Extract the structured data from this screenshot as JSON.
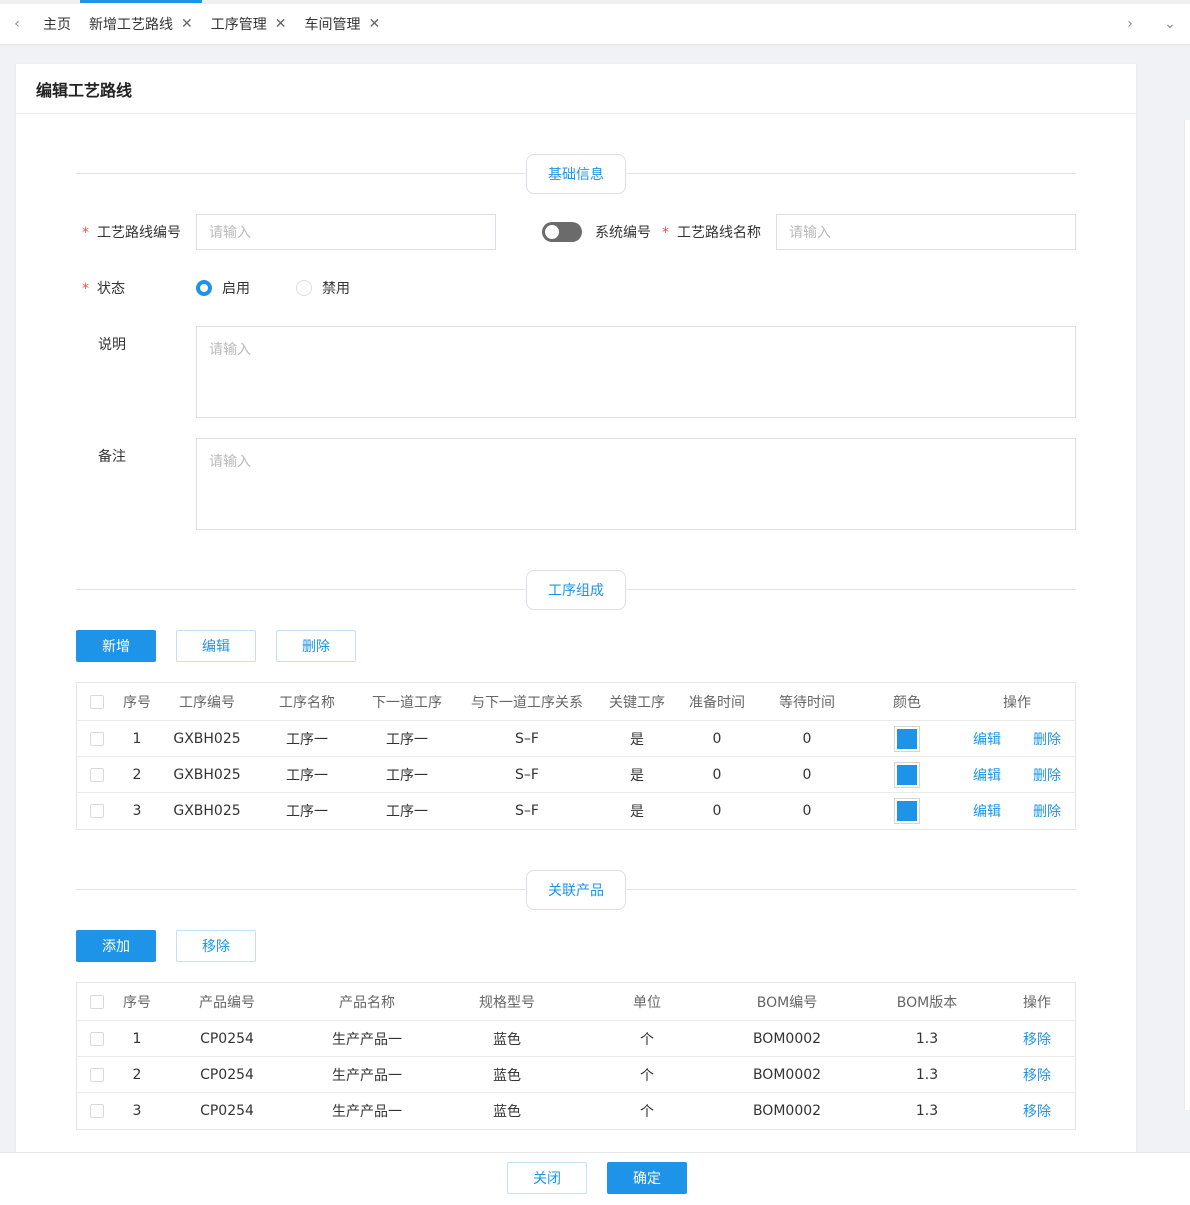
{
  "tabs": [
    {
      "label": "主页",
      "closable": false,
      "active": false
    },
    {
      "label": "新增工艺路线",
      "closable": true,
      "active": true
    },
    {
      "label": "工序管理",
      "closable": true,
      "active": false
    },
    {
      "label": "车间管理",
      "closable": true,
      "active": false
    }
  ],
  "icons": {
    "prev": "‹",
    "next": "›",
    "more": "⌄",
    "close": "✕"
  },
  "panel": {
    "title": "编辑工艺路线"
  },
  "sections": {
    "basic": "基础信息",
    "process": "工序组成",
    "product": "关联产品"
  },
  "form": {
    "route_code_label": "工艺路线编号",
    "route_code_placeholder": "请输入",
    "system_code_label": "系统编号",
    "route_name_label": "工艺路线名称",
    "route_name_placeholder": "请输入",
    "status_label": "状态",
    "status_enabled": "启用",
    "status_disabled": "禁用",
    "desc_label": "说明",
    "desc_placeholder": "请输入",
    "remark_label": "备注",
    "remark_placeholder": "请输入",
    "required_mark": "*"
  },
  "process_toolbar": {
    "add": "新增",
    "edit": "编辑",
    "delete": "删除"
  },
  "process_table": {
    "headers": [
      "序号",
      "工序编号",
      "工序名称",
      "下一道工序",
      "与下一道工序关系",
      "关键工序",
      "准备时间",
      "等待时间",
      "颜色",
      "操作"
    ],
    "rows": [
      {
        "no": "1",
        "code": "GXBH025",
        "name": "工序一",
        "next": "工序一",
        "relation": "S–F",
        "key": "是",
        "prep": "0",
        "wait": "0",
        "color": "#1e94e8",
        "edit": "编辑",
        "delete": "删除"
      },
      {
        "no": "2",
        "code": "GXBH025",
        "name": "工序一",
        "next": "工序一",
        "relation": "S–F",
        "key": "是",
        "prep": "0",
        "wait": "0",
        "color": "#1e94e8",
        "edit": "编辑",
        "delete": "删除"
      },
      {
        "no": "3",
        "code": "GXBH025",
        "name": "工序一",
        "next": "工序一",
        "relation": "S–F",
        "key": "是",
        "prep": "0",
        "wait": "0",
        "color": "#1e94e8",
        "edit": "编辑",
        "delete": "删除"
      }
    ]
  },
  "product_toolbar": {
    "add": "添加",
    "remove": "移除"
  },
  "product_table": {
    "headers": [
      "序号",
      "产品编号",
      "产品名称",
      "规格型号",
      "单位",
      "BOM编号",
      "BOM版本",
      "操作"
    ],
    "rows": [
      {
        "no": "1",
        "code": "CP0254",
        "name": "生产产品一",
        "spec": "蓝色",
        "unit": "个",
        "bom": "BOM0002",
        "ver": "1.3",
        "remove": "移除"
      },
      {
        "no": "2",
        "code": "CP0254",
        "name": "生产产品一",
        "spec": "蓝色",
        "unit": "个",
        "bom": "BOM0002",
        "ver": "1.3",
        "remove": "移除"
      },
      {
        "no": "3",
        "code": "CP0254",
        "name": "生产产品一",
        "spec": "蓝色",
        "unit": "个",
        "bom": "BOM0002",
        "ver": "1.3",
        "remove": "移除"
      }
    ]
  },
  "footer": {
    "close": "关闭",
    "confirm": "确定"
  },
  "colors": {
    "accent": "#1e94e8",
    "required": "#e5534b"
  }
}
